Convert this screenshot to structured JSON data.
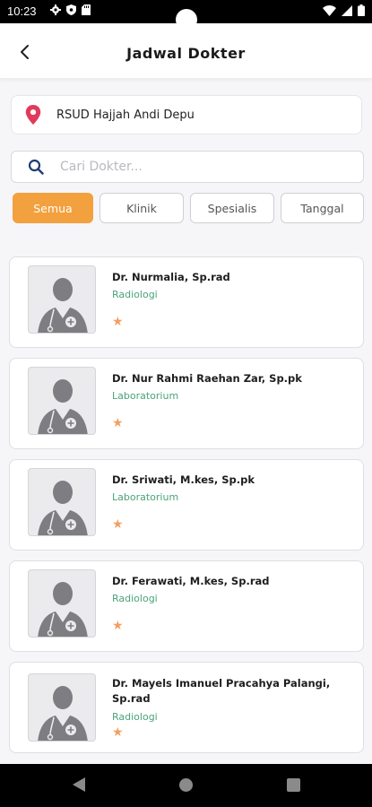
{
  "status_bar": {
    "time": "10:23"
  },
  "header": {
    "title": "Jadwal Dokter"
  },
  "location": {
    "name": "RSUD Hajjah Andi Depu"
  },
  "search": {
    "placeholder": "Cari Dokter..."
  },
  "filters": [
    {
      "label": "Semua",
      "active": true
    },
    {
      "label": "Klinik",
      "active": false
    },
    {
      "label": "Spesialis",
      "active": false
    },
    {
      "label": "Tanggal",
      "active": false
    }
  ],
  "doctors": [
    {
      "name": "Dr. Nurmalia, Sp.rad",
      "specialty": "Radiologi",
      "rating_stars": 1
    },
    {
      "name": "Dr. Nur Rahmi Raehan Zar, Sp.pk",
      "specialty": "Laboratorium",
      "rating_stars": 1
    },
    {
      "name": "Dr. Sriwati, M.kes, Sp.pk",
      "specialty": "Laboratorium",
      "rating_stars": 1
    },
    {
      "name": "Dr. Ferawati, M.kes, Sp.rad",
      "specialty": "Radiologi",
      "rating_stars": 1
    },
    {
      "name": "Dr. Mayels Imanuel Pracahya Palangi, Sp.rad",
      "specialty": "Radiologi",
      "rating_stars": 1
    }
  ],
  "icons": {
    "status": [
      "gear-icon",
      "shield-icon",
      "sd-card-icon",
      "wifi-icon",
      "signal-icon",
      "battery-icon"
    ],
    "location": "map-pin-icon",
    "search": "search-icon",
    "back": "back-arrow-icon",
    "avatar": "doctor-avatar-icon",
    "star": "star-icon",
    "nav": [
      "nav-back-icon",
      "nav-home-icon",
      "nav-recents-icon"
    ]
  },
  "colors": {
    "accent": "#f3a03e",
    "specialty_text": "#4aa37b",
    "star": "#f29f62",
    "location_pin": "#e23b5a",
    "search_icon": "#1f3b7a"
  }
}
